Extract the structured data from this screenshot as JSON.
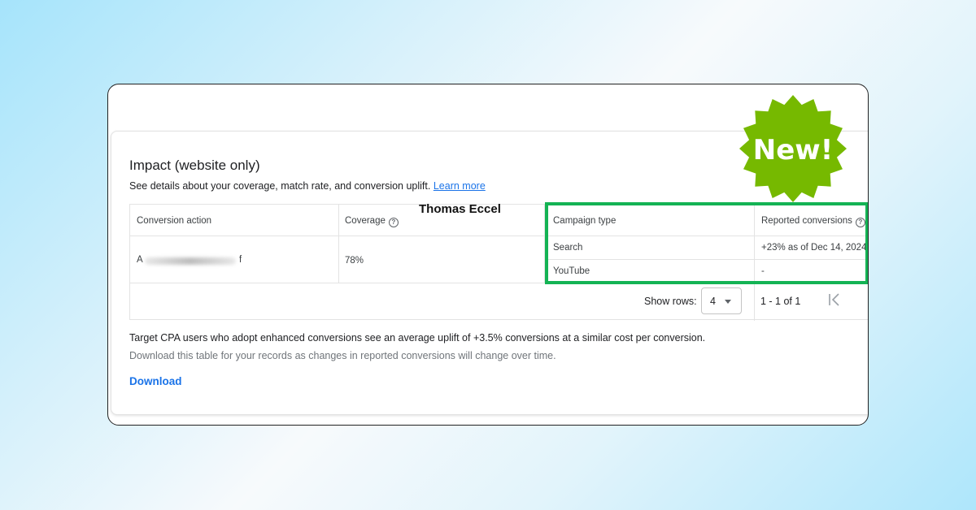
{
  "section": {
    "title": "Impact (website only)",
    "subtitle": "See details about your coverage, match rate, and conversion uplift.",
    "learn_more": "Learn more"
  },
  "table": {
    "headers": {
      "conversion_action": "Conversion action",
      "coverage": "Coverage",
      "campaign_type": "Campaign type",
      "reported_conversions": "Reported conversions"
    },
    "row": {
      "action_start": "A",
      "action_end": "f",
      "coverage": "78%"
    },
    "campaigns": [
      {
        "type": "Search",
        "reported": "+23% as of Dec 14, 2024"
      },
      {
        "type": "YouTube",
        "reported": "-"
      }
    ]
  },
  "pagination": {
    "show_rows_label": "Show rows:",
    "rows_value": "4",
    "range": "1 - 1 of 1"
  },
  "footer": {
    "uplift_text": "Target CPA users who adopt enhanced conversions see an average uplift of +3.5% conversions at a similar cost per conversion.",
    "note": "Download this table for your records as changes in reported conversions will change over time.",
    "download": "Download"
  },
  "watermark": "Thomas Eccel",
  "badge": {
    "text": "New!",
    "color": "#76b900"
  },
  "colors": {
    "highlight": "#14b354",
    "link": "#1a73e8"
  }
}
